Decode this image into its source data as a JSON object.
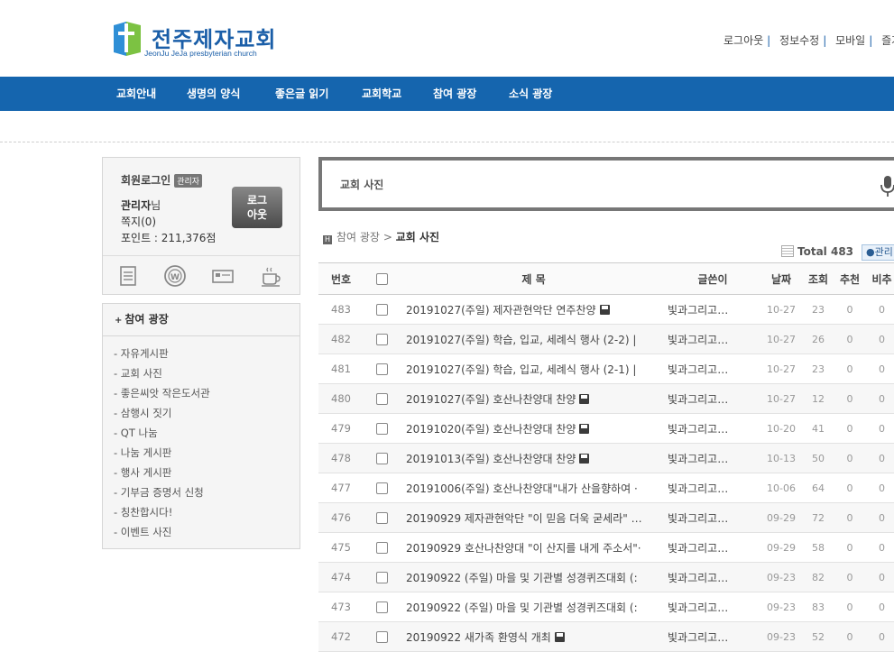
{
  "header": {
    "logo_title": "전주제자교회",
    "logo_sub": "JeonJu JeJa presbyterian church",
    "top_links": [
      "로그아웃",
      "정보수정",
      "모바일",
      "즐겨찾"
    ]
  },
  "gnb": [
    "교회안내",
    "생명의 양식",
    "좋은글 읽기",
    "교회학교",
    "참여 광장",
    "소식 광장"
  ],
  "login": {
    "title": "회원로그인",
    "badge": "관리자",
    "name": "관리자",
    "name_suffix": "님",
    "message": "쪽지(0)",
    "point": "포인트 : 211,376점",
    "logout_line1": "로그",
    "logout_line2": "아웃"
  },
  "side_menu": {
    "title": "참여 광장",
    "items": [
      "- 자유게시판",
      "- 교회 사진",
      "- 좋은씨앗 작은도서관",
      "- 삼행시 짓기",
      "- QT 나눔",
      "- 나눔 게시판",
      "- 행사 게시판",
      "- 기부금 증명서 신청",
      "- 칭찬합시다!",
      "- 이벤트 사진"
    ]
  },
  "search": {
    "label": "교회 사진"
  },
  "breadcrumb": {
    "parent": "참여 광장",
    "sep": ">",
    "current": "교회 사진"
  },
  "total": {
    "label": "Total",
    "count": "483"
  },
  "admin_button": "관리",
  "table": {
    "headers": [
      "번호",
      "",
      "제  목",
      "글쓴이",
      "날짜",
      "조회",
      "추천",
      "비추"
    ],
    "rows": [
      {
        "num": "483",
        "title": "20191027(주일) 제자관현악단 연주찬양",
        "file": true,
        "author": "빛과그리고…",
        "date": "10-27",
        "views": "23",
        "rec": "0",
        "extra": "0"
      },
      {
        "num": "482",
        "title": "20191027(주일) 학습, 입교, 세례식 행사 (2-2) |",
        "file": false,
        "author": "빛과그리고…",
        "date": "10-27",
        "views": "26",
        "rec": "0",
        "extra": "0"
      },
      {
        "num": "481",
        "title": "20191027(주일) 학습, 입교, 세례식 행사 (2-1) |",
        "file": false,
        "author": "빛과그리고…",
        "date": "10-27",
        "views": "23",
        "rec": "0",
        "extra": "0"
      },
      {
        "num": "480",
        "title": "20191027(주일) 호산나찬양대 찬양",
        "file": true,
        "author": "빛과그리고…",
        "date": "10-27",
        "views": "12",
        "rec": "0",
        "extra": "0"
      },
      {
        "num": "479",
        "title": "20191020(주일) 호산나찬양대 찬양",
        "file": true,
        "author": "빛과그리고…",
        "date": "10-20",
        "views": "41",
        "rec": "0",
        "extra": "0"
      },
      {
        "num": "478",
        "title": "20191013(주일) 호산나찬양대 찬양",
        "file": true,
        "author": "빛과그리고…",
        "date": "10-13",
        "views": "50",
        "rec": "0",
        "extra": "0"
      },
      {
        "num": "477",
        "title": "20191006(주일) 호산나찬양대\"내가 산을향하여 ·",
        "file": false,
        "author": "빛과그리고…",
        "date": "10-06",
        "views": "64",
        "rec": "0",
        "extra": "0"
      },
      {
        "num": "476",
        "title": "20190929 제자관현악단 \"이 믿음 더욱 굳세라\" …",
        "file": false,
        "author": "빛과그리고…",
        "date": "09-29",
        "views": "72",
        "rec": "0",
        "extra": "0"
      },
      {
        "num": "475",
        "title": "20190929 호산나찬양대 \"이 산지를 내게 주소서\"·",
        "file": false,
        "author": "빛과그리고…",
        "date": "09-29",
        "views": "58",
        "rec": "0",
        "extra": "0"
      },
      {
        "num": "474",
        "title": "20190922 (주일) 마을 및 기관별 성경퀴즈대회 (:",
        "file": false,
        "author": "빛과그리고…",
        "date": "09-23",
        "views": "82",
        "rec": "0",
        "extra": "0"
      },
      {
        "num": "473",
        "title": "20190922 (주일) 마을 및 기관별 성경퀴즈대회 (:",
        "file": false,
        "author": "빛과그리고…",
        "date": "09-23",
        "views": "83",
        "rec": "0",
        "extra": "0"
      },
      {
        "num": "472",
        "title": "20190922 새가족 환영식 개최",
        "file": true,
        "author": "빛과그리고…",
        "date": "09-23",
        "views": "52",
        "rec": "0",
        "extra": "0"
      }
    ]
  }
}
